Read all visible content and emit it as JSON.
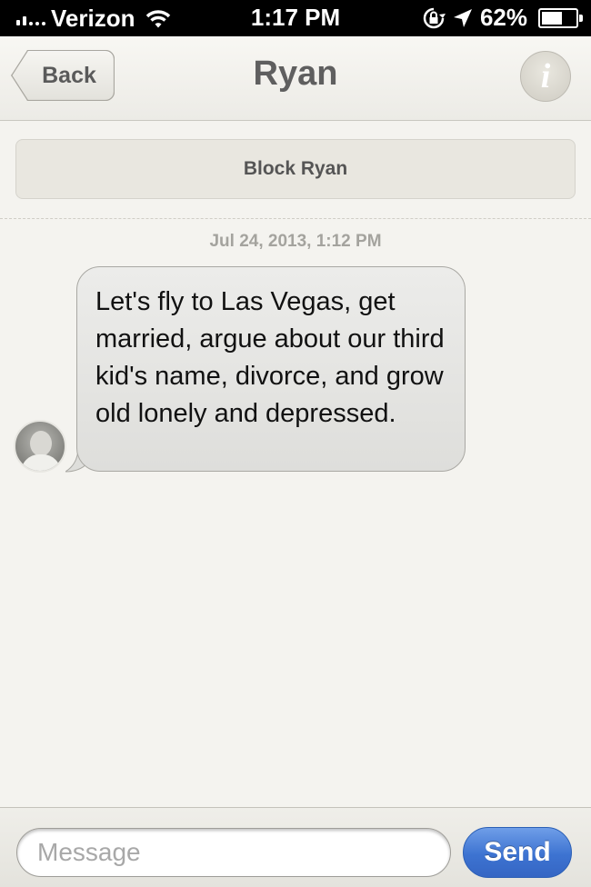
{
  "status_bar": {
    "carrier": "Verizon",
    "time": "1:17 PM",
    "battery": "62%",
    "battery_level": 0.62,
    "icons": [
      "signal-icon",
      "wifi-icon",
      "rotation-lock-icon",
      "location-arrow-icon",
      "battery-icon"
    ]
  },
  "nav": {
    "back_label": "Back",
    "title": "Ryan",
    "info_glyph": "i"
  },
  "actions": {
    "block_label": "Block Ryan"
  },
  "conversation": {
    "timestamp": "Jul 24, 2013, 1:12 PM",
    "messages": [
      {
        "sender": "Ryan",
        "direction": "incoming",
        "text": "Let's fly to Las Vegas, get married, argue about our third kid's name, divorce, and grow old lonely and depressed."
      }
    ]
  },
  "composer": {
    "placeholder": "Message",
    "value": "",
    "send_label": "Send"
  },
  "colors": {
    "send_button": "#3d73d1",
    "background": "#f4f3ef",
    "status_bar": "#000000"
  }
}
